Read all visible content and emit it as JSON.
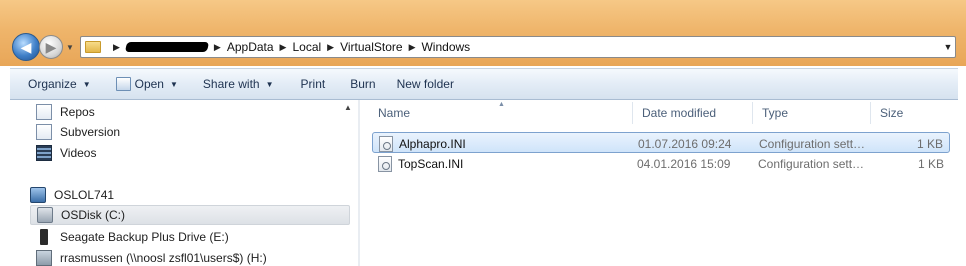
{
  "address_bar": {
    "crumbs": [
      "AppData",
      "Local",
      "VirtualStore",
      "Windows"
    ]
  },
  "toolbar": {
    "organize": "Organize",
    "open": "Open",
    "share_with": "Share with",
    "print": "Print",
    "burn": "Burn",
    "new_folder": "New folder"
  },
  "nav": {
    "items": [
      {
        "label": "Repos",
        "icon": "document-library-icon"
      },
      {
        "label": "Subversion",
        "icon": "document-library-icon"
      },
      {
        "label": "Videos",
        "icon": "videos-icon"
      },
      {
        "label": "OSLOL741",
        "icon": "computer-icon"
      },
      {
        "label": "OSDisk (C:)",
        "icon": "hard-disk-icon",
        "selected": true
      },
      {
        "label": "Seagate Backup Plus Drive (E:)",
        "icon": "external-drive-icon"
      },
      {
        "label": "rrasmussen (\\\\noosl zsfl01\\users$) (H:)",
        "icon": "network-drive-icon"
      }
    ]
  },
  "columns": {
    "name": "Name",
    "date_modified": "Date modified",
    "type": "Type",
    "size": "Size"
  },
  "files": [
    {
      "name": "Alphapro.INI",
      "date": "01.07.2016 09:24",
      "type": "Configuration sett…",
      "size": "1 KB",
      "selected": true
    },
    {
      "name": "TopScan.INI",
      "date": "04.01.2016 15:09",
      "type": "Configuration sett…",
      "size": "1 KB",
      "selected": false
    }
  ]
}
